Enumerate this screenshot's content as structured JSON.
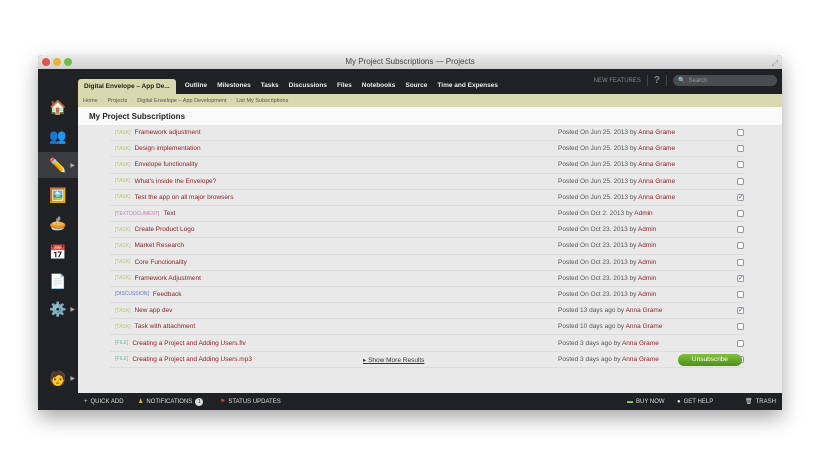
{
  "window": {
    "title": "My Project Subscriptions — Projects"
  },
  "nav": {
    "project_tab": "Digital Envelope – App De...",
    "tabs": [
      "Outline",
      "Milestones",
      "Tasks",
      "Discussions",
      "Files",
      "Notebooks",
      "Source",
      "Time and Expenses"
    ],
    "new_features": "NEW FEATURES",
    "help": "?",
    "search_placeholder": "Search"
  },
  "breadcrumb": [
    "Home",
    "Projects",
    "Digital Envelope – App Development",
    "List My Subscriptions"
  ],
  "page_title": "My Project Subscriptions",
  "rows": [
    {
      "type": "[TASK]",
      "title": "Framework adjustment",
      "posted": "Posted On Jun 25. 2013 by",
      "author": "Anna Grame",
      "checked": false
    },
    {
      "type": "[TASK]",
      "title": "Design implementation",
      "posted": "Posted On Jun 25. 2013 by",
      "author": "Anna Grame",
      "checked": false
    },
    {
      "type": "[TASK]",
      "title": "Envelope functionality",
      "posted": "Posted On Jun 25. 2013 by",
      "author": "Anna Grame",
      "checked": false
    },
    {
      "type": "[TASK]",
      "title": "What's inside the Envelope?",
      "posted": "Posted On Jun 25. 2013 by",
      "author": "Anna Grame",
      "checked": false
    },
    {
      "type": "[TASK]",
      "title": "Test the app on all major browsers",
      "posted": "Posted On Jun 25. 2013 by",
      "author": "Anna Grame",
      "checked": true
    },
    {
      "type": "[TEXTDOCUMENT]",
      "title": "Text",
      "posted": "Posted On Oct 2. 2013 by",
      "author": "Admin",
      "checked": false
    },
    {
      "type": "[TASK]",
      "title": "Create Product Logo",
      "posted": "Posted On Oct 23. 2013 by",
      "author": "Admin",
      "checked": false
    },
    {
      "type": "[TASK]",
      "title": "Market Research",
      "posted": "Posted On Oct 23. 2013 by",
      "author": "Admin",
      "checked": false
    },
    {
      "type": "[TASK]",
      "title": "Core Functionality",
      "posted": "Posted On Oct 23. 2013 by",
      "author": "Admin",
      "checked": false
    },
    {
      "type": "[TASK]",
      "title": "Framework Adjustment",
      "posted": "Posted On Oct 23. 2013 by",
      "author": "Admin",
      "checked": true
    },
    {
      "type": "[DISCUSSION]",
      "title": "Feedback",
      "posted": "Posted On Oct 23. 2013 by",
      "author": "Admin",
      "checked": false
    },
    {
      "type": "[TASK]",
      "title": "New app dev",
      "posted": "Posted 13 days ago by",
      "author": "Anna Grame",
      "checked": true
    },
    {
      "type": "[TASK]",
      "title": "Task with attachment",
      "posted": "Posted 10 days ago by",
      "author": "Anna Grame",
      "checked": false
    },
    {
      "type": "[FILE]",
      "title": "Creating a Project and Adding Users.flv",
      "posted": "Posted 3 days ago by",
      "author": "Anna Grame",
      "checked": false
    },
    {
      "type": "[FILE]",
      "title": "Creating a Project and Adding Users.mp3",
      "posted": "Posted 3 days ago by",
      "author": "Anna Grame",
      "checked": false
    }
  ],
  "type_colors": {
    "[TASK]": "#b8c86a",
    "[TEXTDOCUMENT]": "#c87ab8",
    "[DISCUSSION]": "#5a7ad0",
    "[FILE]": "#6ab8a8"
  },
  "show_more": "Show More Results",
  "unsubscribe": "Unsubscribe",
  "footer": {
    "quick_add": "QUICK ADD",
    "notifications": "NOTIFICATIONS",
    "notification_count": "1",
    "status_updates": "STATUS UPDATES",
    "buy_now": "BUY NOW",
    "get_help": "GET HELP",
    "trash": "TRASH"
  }
}
